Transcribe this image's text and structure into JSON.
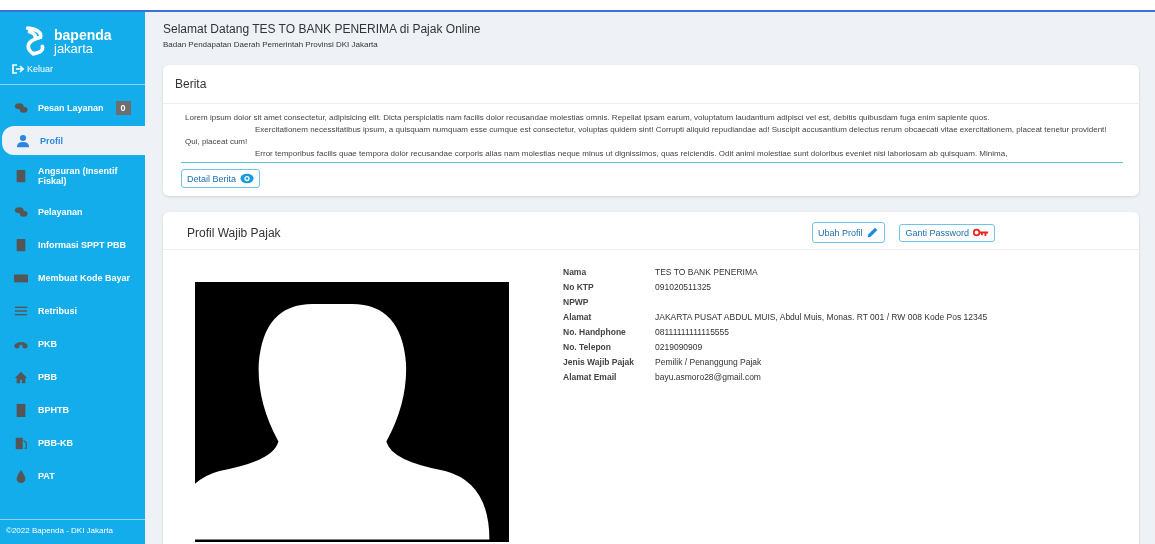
{
  "sidebar": {
    "brand": {
      "name": "bapenda",
      "sub": "jakarta"
    },
    "logout": "Keluar",
    "items": [
      {
        "label": "Pesan Layanan",
        "badge": "0",
        "selected": false
      },
      {
        "label": "Profil",
        "selected": true
      },
      {
        "label": "Angsuran (Insentif Fiskal)",
        "selected": false
      },
      {
        "label": "Pelayanan",
        "selected": false
      },
      {
        "label": "Informasi SPPT PBB",
        "selected": false
      },
      {
        "label": "Membuat Kode Bayar",
        "selected": false
      },
      {
        "label": "Retribusi",
        "selected": false
      },
      {
        "label": "PKB",
        "selected": false
      },
      {
        "label": "PBB",
        "selected": false
      },
      {
        "label": "BPHTB",
        "selected": false
      },
      {
        "label": "PBB-KB",
        "selected": false
      },
      {
        "label": "PAT",
        "selected": false
      }
    ],
    "footer": "©2022 Bapenda - DKI Jakarta"
  },
  "header": {
    "title": "Selamat Datang TES TO BANK PENERIMA di Pajak Online",
    "subtitle": "Badan Pendapatan Daerah Pemerintah Provinsi DKI Jakarta"
  },
  "news": {
    "title": "Berita",
    "paragraphs": [
      "Lorem ipsum dolor sit amet consectetur, adipisicing elit. Dicta perspiciatis nam facilis dolor recusandae molestias omnis. Repellat ipsam earum, voluptatum laudantium adipisci vel est, debitis quibusdam fuga enim sapiente quos.",
      "Exercitationem necessitatibus ipsum, a quisquam numquam esse cumque est consectetur, voluptas quidem sint! Corrupti aliquid repudiandae ad! Suscipit accusantium delectus rerum obcaecati vitae exercitationem, placeat tenetur provident! Qui, placeat cum!",
      "Error temporibus facilis quae tempora dolor recusandae corporis alias nam molestias neque minus ut dignissimos, quas reiciendis. Odit animi molestiae sunt doloribus eveniet nisi laboriosam ab quisquam. Minima,"
    ],
    "button": "Detail Berita"
  },
  "profile": {
    "title": "Profil Wajib Pajak",
    "edit_button": "Ubah Profil",
    "password_button": "Ganti Password",
    "fields": [
      {
        "label": "Nama",
        "value": "TES TO BANK PENERIMA"
      },
      {
        "label": "No KTP",
        "value": "091020511325"
      },
      {
        "label": "NPWP"
      },
      {
        "label": "Alamat",
        "value": "JAKARTA PUSAT ABDUL MUIS, Abdul Muis, Monas. RT 001 / RW 008 Kode Pos 12345"
      },
      {
        "label": "No. Handphone",
        "value": "08111111111115555"
      },
      {
        "label": "No. Telepon",
        "value": "0219090909"
      },
      {
        "label": "Jenis Wajib Pajak",
        "value": "Pemilik / Penanggung Pajak"
      },
      {
        "label": "Alamat Email",
        "value": "bayu.asmoro28@gmail.com"
      }
    ]
  }
}
